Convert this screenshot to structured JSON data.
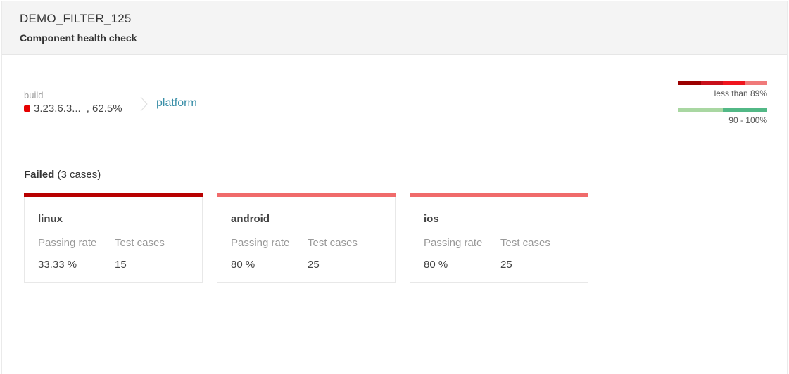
{
  "header": {
    "title": "DEMO_FILTER_125",
    "subtitle": "Component health check"
  },
  "summary": {
    "build_label": "build",
    "build_version": "3.23.6.3...",
    "build_rate": ", 62.5%",
    "status_color": "#e60000",
    "platform_link": "platform"
  },
  "legend": {
    "low": {
      "label": "less than 89%",
      "colors": [
        "#9b0000",
        "#c8101a",
        "#f0151e",
        "#f07a7a"
      ]
    },
    "high": {
      "label": "90 - 100%",
      "colors": [
        "#a9d7a2",
        "#52b886"
      ]
    }
  },
  "failed": {
    "label": "Failed",
    "count_text": "(3 cases)"
  },
  "cards": [
    {
      "name": "linux",
      "color": "#b80000",
      "passing_label": "Passing rate",
      "cases_label": "Test cases",
      "passing_rate": "33.33 %",
      "test_cases": "15"
    },
    {
      "name": "android",
      "color": "#f06b6b",
      "passing_label": "Passing rate",
      "cases_label": "Test cases",
      "passing_rate": "80 %",
      "test_cases": "25"
    },
    {
      "name": "ios",
      "color": "#f06b6b",
      "passing_label": "Passing rate",
      "cases_label": "Test cases",
      "passing_rate": "80 %",
      "test_cases": "25"
    }
  ]
}
